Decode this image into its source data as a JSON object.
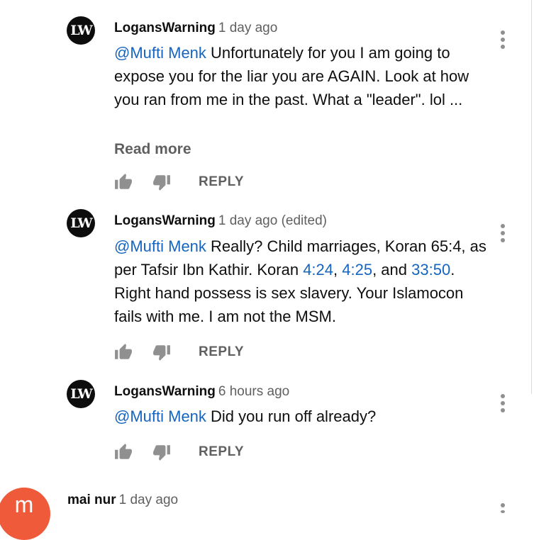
{
  "comments": [
    {
      "avatar_text": "LW",
      "author": "LogansWarning",
      "time": "1 day ago",
      "mention": "@Mufti Menk",
      "text": " Unfortunately for you I am going to expose you for the liar you are AGAIN. Look at how you ran from me in the past. What a \"leader\". lol ...",
      "read_more": "Read more",
      "reply": "REPLY"
    },
    {
      "avatar_text": "LW",
      "author": "LogansWarning",
      "time": "1 day ago (edited)",
      "mention": "@Mufti Menk",
      "text_1": " Really? Child marriages, Koran 65:4, as per Tafsir Ibn Kathir. Koran ",
      "link_1": "4:24",
      "sep_1": ", ",
      "link_2": "4:25",
      "sep_2": ", and ",
      "link_3": "33:50",
      "text_2": ". Right hand possess is sex slavery. Your Islamocon fails with me. I am not the MSM.",
      "reply": "REPLY"
    },
    {
      "avatar_text": "LW",
      "author": "LogansWarning",
      "time": "6 hours ago",
      "mention": "@Mufti Menk",
      "text": " Did you run off already?",
      "reply": "REPLY"
    },
    {
      "avatar_text": "m",
      "author": "mai nur",
      "time": "1 day ago",
      "avatar_color": "#ef5b3a"
    }
  ],
  "colors": {
    "link": "#1565c0",
    "secondary_text": "#606060",
    "icon": "#909090"
  },
  "icons": {
    "like": "thumbs-up-icon",
    "dislike": "thumbs-down-icon",
    "menu": "more-vertical-icon"
  }
}
